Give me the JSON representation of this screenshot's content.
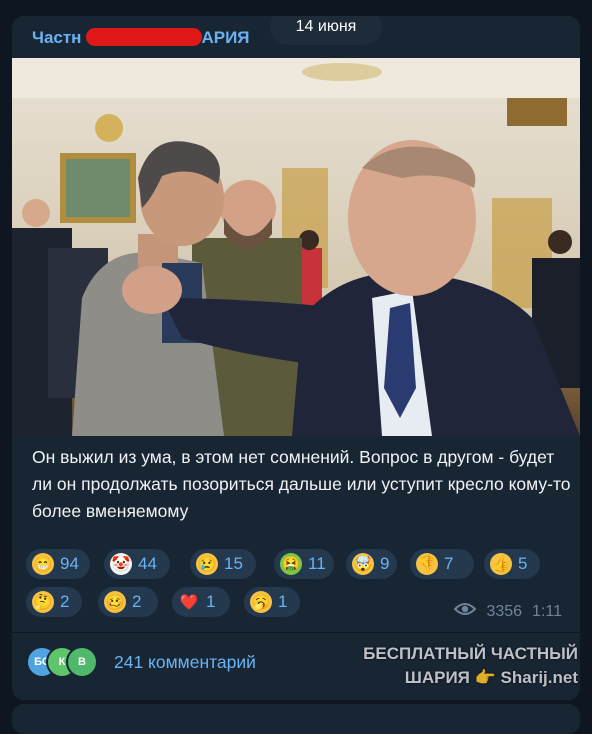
{
  "post": {
    "channel_title_visible_start": "Частн",
    "channel_title_visible_end": "АРИЯ",
    "date_badge": "14 июня",
    "text": "Он выжил из ума, в этом нет сомнений. Вопрос в другом - будет ли он продолжать позориться дальше или уступит кресло кому-то более вменяемому"
  },
  "reactions": [
    {
      "emoji": "😁",
      "count": "94"
    },
    {
      "emoji": "🤡",
      "count": "44"
    },
    {
      "emoji": "😢",
      "count": "15"
    },
    {
      "emoji": "🤮",
      "count": "11"
    },
    {
      "emoji": "🤯",
      "count": "9"
    },
    {
      "emoji": "👎",
      "count": "7"
    },
    {
      "emoji": "👍",
      "count": "5"
    },
    {
      "emoji": "🤔",
      "count": "2"
    },
    {
      "emoji": "🥴",
      "count": "2"
    },
    {
      "emoji": "❤️",
      "count": "1"
    },
    {
      "emoji": "🥱",
      "count": "1"
    }
  ],
  "meta": {
    "views": "3356",
    "time": "1:11"
  },
  "comments": {
    "avatars": [
      {
        "initials": "БС",
        "color": "#4fa3e0"
      },
      {
        "initials": "К",
        "color": "#5fc56a"
      },
      {
        "initials": "В",
        "color": "#4fb86a"
      }
    ],
    "label": "241 комментарий"
  },
  "watermark": {
    "line1": "БЕСПЛАТНЫЙ ЧАСТНЫЙ",
    "line2_left": "ШАРИЯ",
    "line2_right": "Sharij.net"
  },
  "colors": {
    "background": "#0e1621",
    "bubble": "#182533",
    "accent": "#6ab3f3",
    "reaction_bg": "#24394e",
    "redaction": "#e01818"
  }
}
